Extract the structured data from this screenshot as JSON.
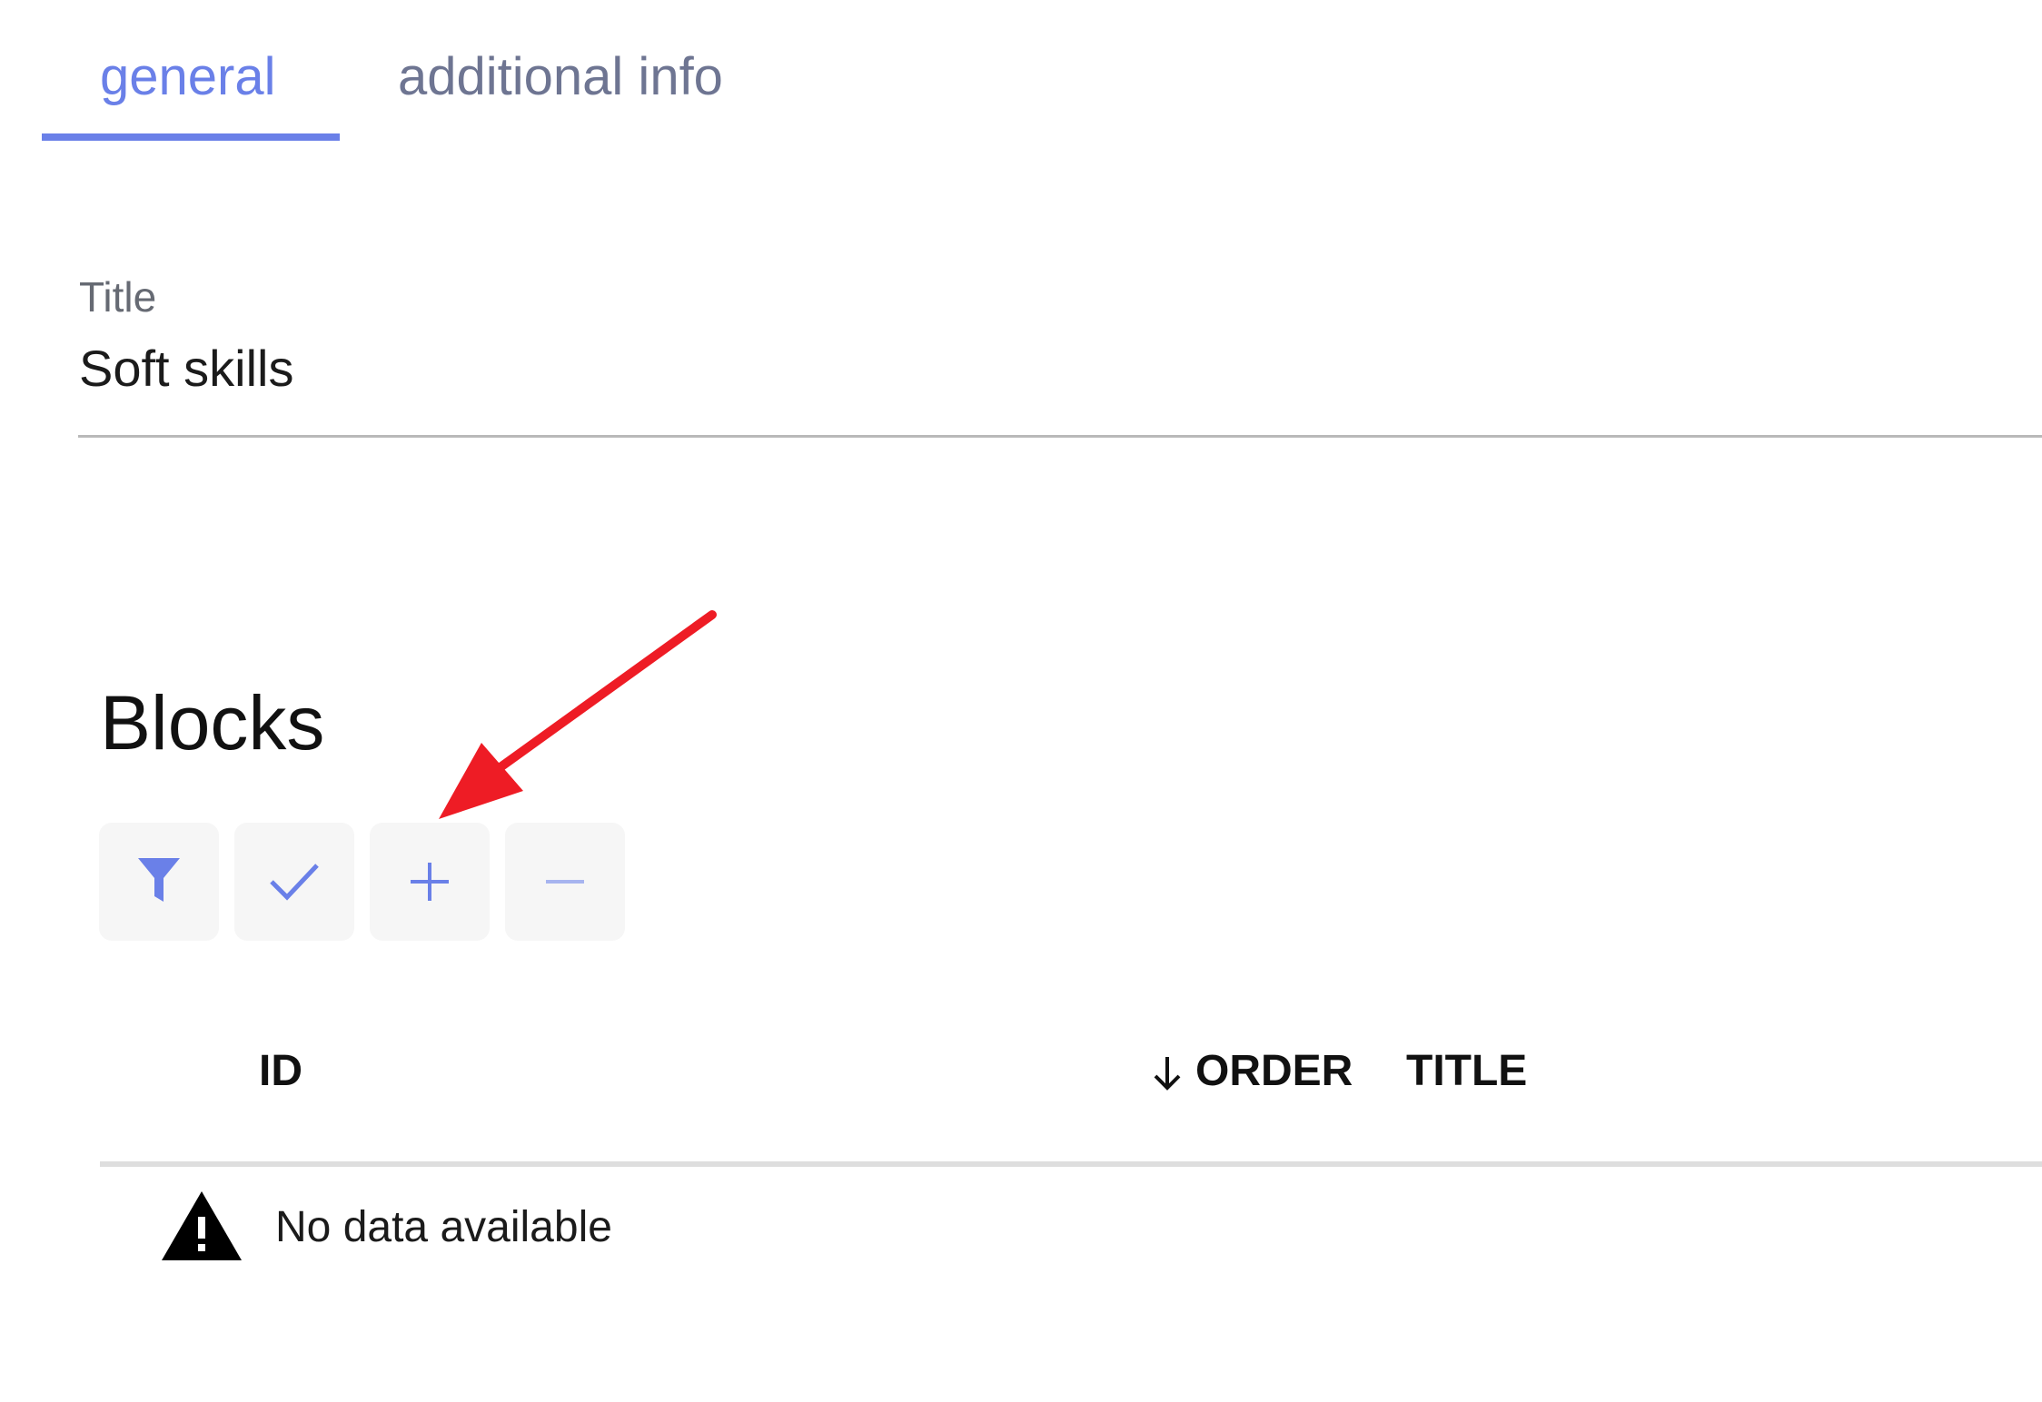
{
  "tabs": [
    {
      "label": "general",
      "active": true
    },
    {
      "label": "additional info",
      "active": false
    }
  ],
  "title_field": {
    "label": "Title",
    "value": "Soft skills"
  },
  "blocks": {
    "heading": "Blocks",
    "toolbar": [
      {
        "icon": "filter-icon",
        "action": "filter"
      },
      {
        "icon": "check-icon",
        "action": "select"
      },
      {
        "icon": "plus-icon",
        "action": "add"
      },
      {
        "icon": "minus-icon",
        "action": "remove"
      }
    ],
    "table": {
      "columns": [
        "ID",
        "ORDER",
        "TITLE"
      ],
      "sorted_column": "ORDER",
      "sort_direction": "descending",
      "empty_message": "No data available"
    }
  },
  "colors": {
    "accent": "#6a80e8",
    "annotation_arrow": "#ee1c25"
  }
}
